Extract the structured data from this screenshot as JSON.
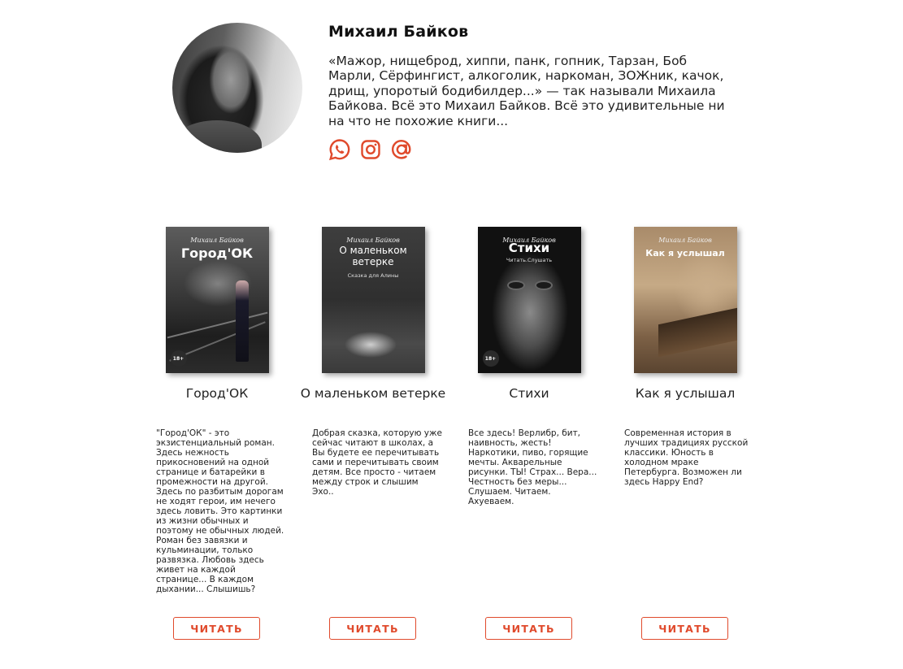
{
  "author": {
    "name": "Михаил Байков",
    "bio": "«Мажор, нищеброд, хиппи, панк, гопник, Тарзан, Боб Марли, Сёрфингист, алкоголик, наркоман, ЗОЖник, качок, дрищ, упоротый бодибилдер...» — так называли Михаила Байкова. Всё это Михаил Байков. Всё это удивительные ни на что не похожие книги..."
  },
  "socials": [
    {
      "icon": "whatsapp-icon"
    },
    {
      "icon": "instagram-icon"
    },
    {
      "icon": "email-at-icon"
    }
  ],
  "accent_color": "#e04a2c",
  "books": [
    {
      "cover_author": "Михаил Байков",
      "cover_title": "Город'ОК",
      "cover_badge": "18+",
      "title": "Город'ОК",
      "description": "\"Город'ОК\" - это экзистенциальный роман. Здесь нежность прикосновений на одной странице и батарейки в промежности на другой. Здесь по разбитым дорогам не ходят герои, им нечего здесь ловить. Это картинки из жизни обычных и поэтому не обычных людей. Роман без завязки и кульминации, только развязка. Любовь здесь живет на каждой странице... В каждом дыхании... Слышишь?",
      "button": "ЧИТАТЬ"
    },
    {
      "cover_author": "Михаил Байков",
      "cover_title": "О маленьком ветерке",
      "cover_subtitle": "Сказка для Алины",
      "title": "О маленьком ветерке",
      "description": "Добрая сказка, которую уже сейчас читают в школах, а Вы будете ее перечитывать сами и перечитывать своим детям. Все просто - читаем между строк и слышим Эхо..",
      "button": "ЧИТАТЬ"
    },
    {
      "cover_author": "Михаил Байков",
      "cover_title": "Стихи",
      "cover_subtitle": "Читать.Слушать",
      "cover_badge": "18+",
      "title": "Стихи",
      "description": "Все здесь! Верлибр, бит, наивность, жесть! Наркотики, пиво, горящие мечты. Акварельные рисунки. ТЫ! Страх... Вера... Честность без меры... Слушаем. Читаем. Ахуеваем.",
      "button": "ЧИТАТЬ"
    },
    {
      "cover_author": "Михаил Байков",
      "cover_title": "Как я услышал",
      "title": "Как я услышал",
      "description": "Современная история в лучших традициях русской классики. Юность в холодном мраке Петербурга. Возможен ли здесь Happy End?",
      "button": "ЧИТАТЬ"
    }
  ]
}
